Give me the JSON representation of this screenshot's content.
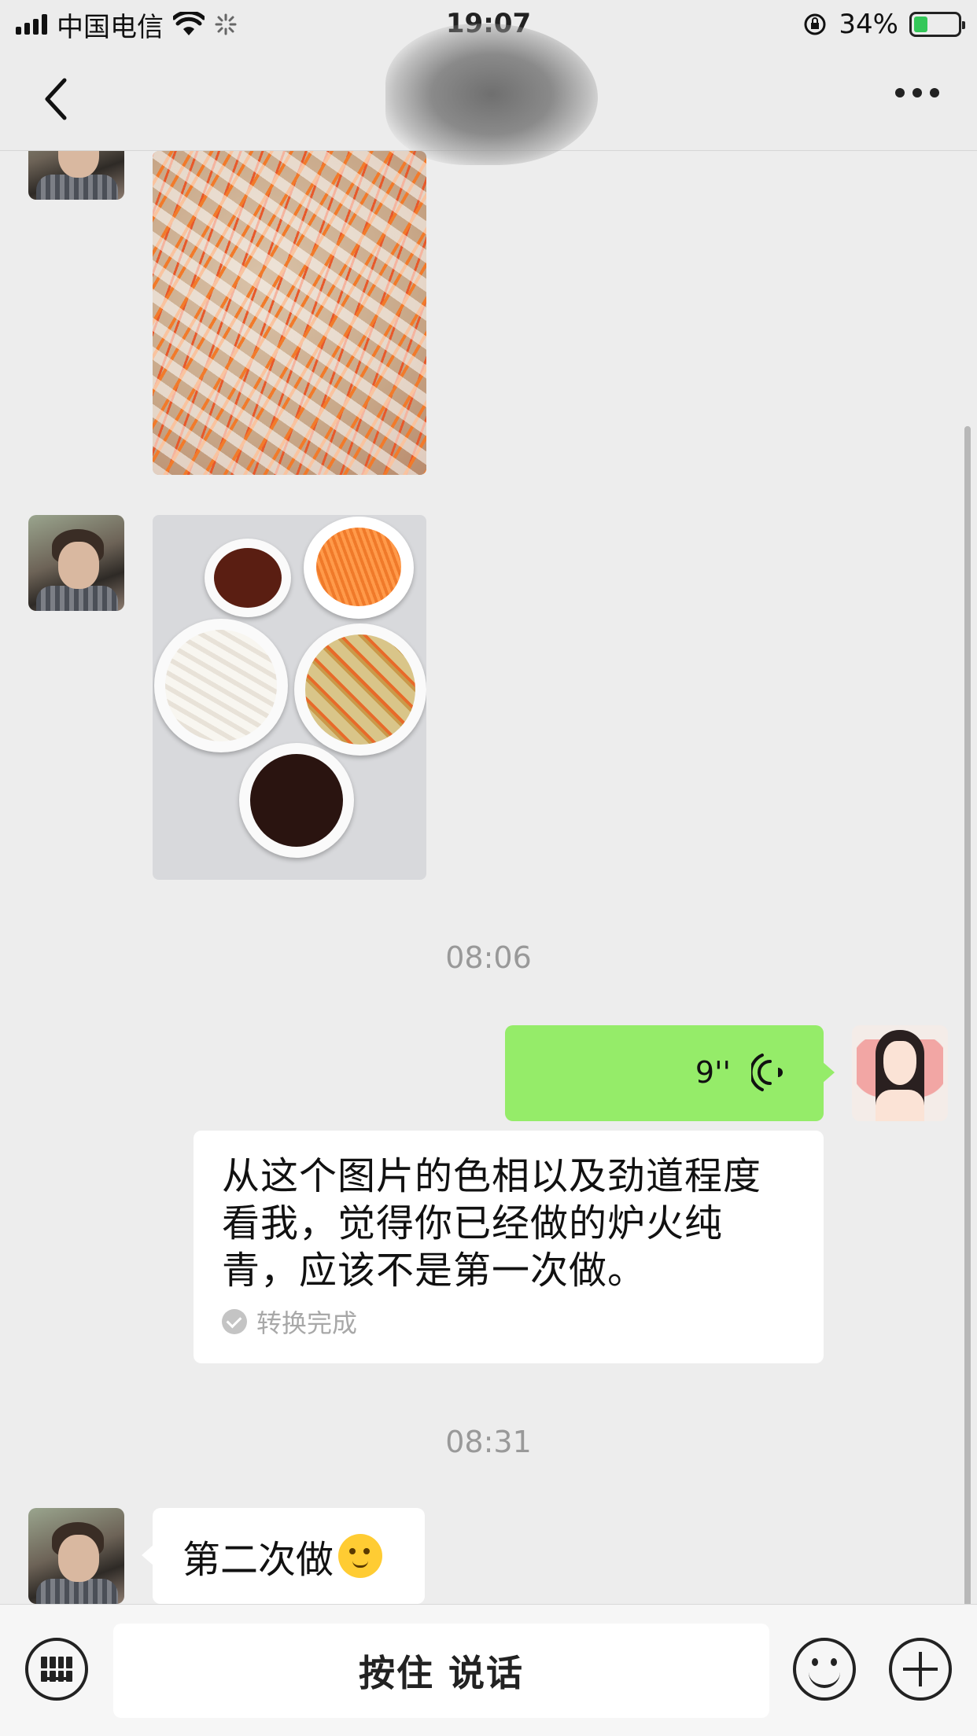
{
  "status_bar": {
    "carrier": "中国电信",
    "time": "19:07",
    "battery_percent": "34%",
    "battery_level": 0.34,
    "icons": [
      "signal-icon",
      "wifi-icon",
      "loading-icon",
      "orientation-lock-icon",
      "battery-charging-icon"
    ]
  },
  "nav": {
    "back_icon": "chevron-left-icon",
    "more_icon": "more-icon"
  },
  "messages": [
    {
      "type": "image",
      "from": "contact",
      "description_icon": "food-photo"
    },
    {
      "type": "image",
      "from": "contact",
      "description_icon": "food-photo"
    },
    {
      "type": "time",
      "text": "08:06"
    },
    {
      "type": "voice",
      "from": "me",
      "duration": "9''"
    },
    {
      "type": "transcription",
      "text": "从这个图片的色相以及劲道程度看我，觉得你已经做的炉火纯青，应该不是第一次做。",
      "status": "转换完成"
    },
    {
      "type": "time",
      "text": "08:31"
    },
    {
      "type": "text",
      "from": "contact",
      "text": "第二次做",
      "emoji": "thinking-face-icon"
    }
  ],
  "input_bar": {
    "hold_to_talk": "按住 说话"
  },
  "colors": {
    "my_bubble": "#95ec69",
    "background": "#ededed",
    "time_text": "#999999"
  }
}
